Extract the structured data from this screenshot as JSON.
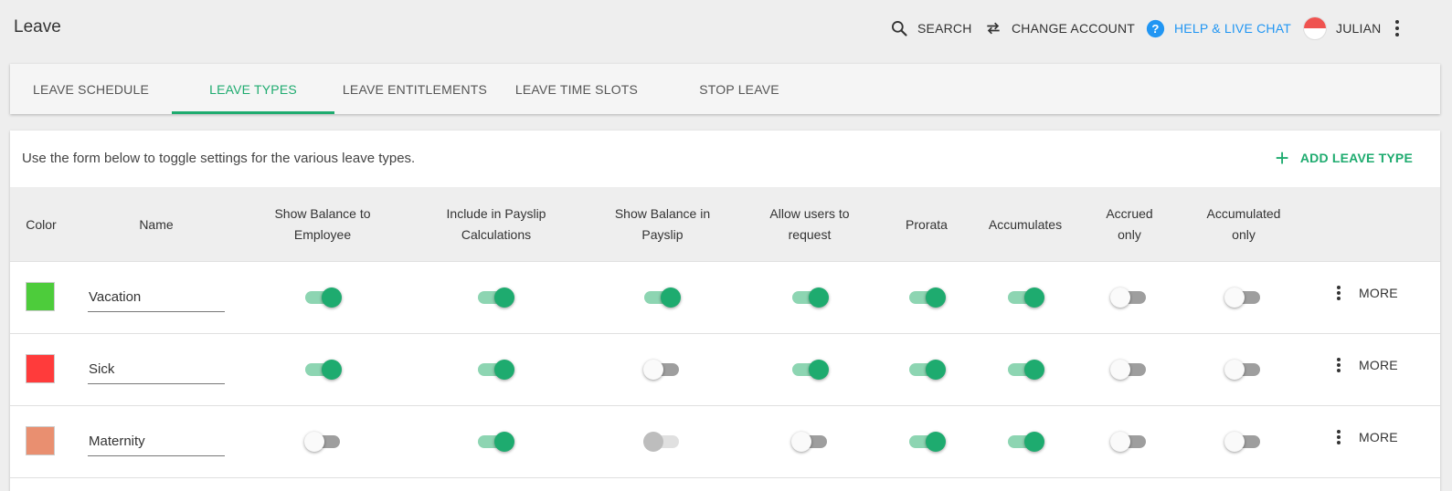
{
  "app": {
    "title": "Leave"
  },
  "topbar": {
    "search_label": "SEARCH",
    "change_account_label": "CHANGE ACCOUNT",
    "help_label": "HELP & LIVE CHAT",
    "user_label": "JULIAN"
  },
  "tabs": [
    {
      "label": "LEAVE SCHEDULE",
      "active": false
    },
    {
      "label": "LEAVE TYPES",
      "active": true
    },
    {
      "label": "LEAVE ENTITLEMENTS",
      "active": false
    },
    {
      "label": "LEAVE TIME SLOTS",
      "active": false
    },
    {
      "label": "STOP LEAVE",
      "active": false
    }
  ],
  "card": {
    "intro": "Use the form below to toggle settings for the various leave types.",
    "add_label": "ADD LEAVE TYPE"
  },
  "table": {
    "headers": {
      "color": "Color",
      "name": "Name",
      "show_balance_employee": [
        "Show Balance to",
        "Employee"
      ],
      "include_payslip": [
        "Include in Payslip",
        "Calculations"
      ],
      "show_balance_payslip": [
        "Show Balance in",
        "Payslip"
      ],
      "allow_request": [
        "Allow users to",
        "request"
      ],
      "prorata": "Prorata",
      "accumulates": "Accumulates",
      "accrued_only": [
        "Accrued",
        "only"
      ],
      "accumulated_only": [
        "Accumulated",
        "only"
      ]
    },
    "more_label": "MORE",
    "rows": [
      {
        "name": "Vacation",
        "color": "#4dcc3b",
        "toggles": [
          "on",
          "on",
          "on",
          "on",
          "on",
          "on",
          "off",
          "off"
        ]
      },
      {
        "name": "Sick",
        "color": "#ff3b3b",
        "toggles": [
          "on",
          "on",
          "off",
          "on",
          "on",
          "on",
          "off",
          "off"
        ]
      },
      {
        "name": "Maternity",
        "color": "#e98f70",
        "toggles": [
          "off",
          "on",
          "disabled",
          "off",
          "on",
          "on",
          "off",
          "off"
        ]
      }
    ]
  },
  "colors": {
    "accent": "#1eab6f",
    "help": "#2196f3"
  }
}
